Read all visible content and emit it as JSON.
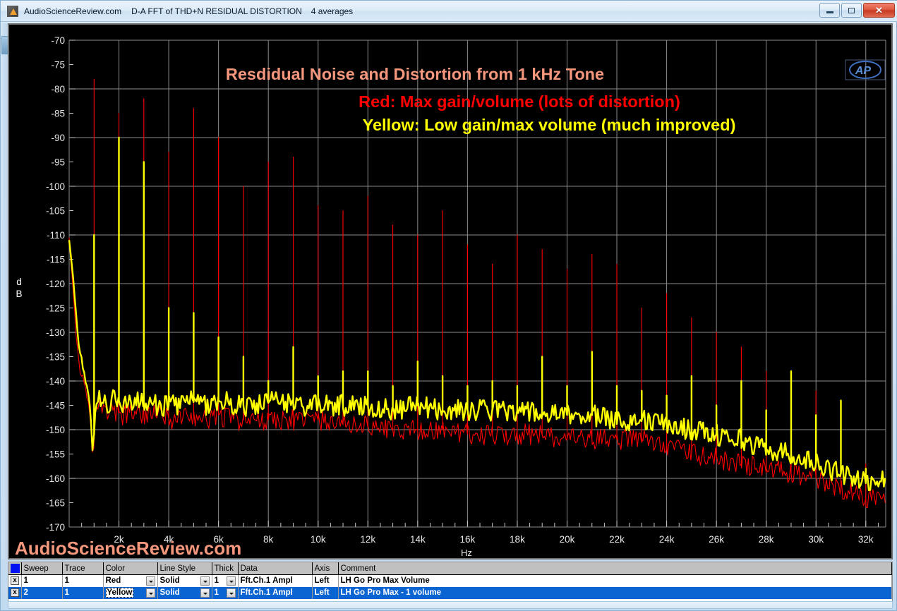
{
  "window": {
    "app_icon": "ap-app-icon",
    "title_site": "AudioScienceReview.com",
    "title_desc": "D-A FFT of THD+N RESIDUAL DISTORTION",
    "title_averages": "4 averages",
    "minimize_label": "–",
    "maximize_label": "□",
    "close_label": "✕"
  },
  "graph": {
    "ap_logo": "AP",
    "watermark": "AudioScienceReview.com",
    "watermark_color": "#F4977D",
    "annotations": [
      {
        "text": "Resdidual Noise and Distortion from 1 kHz Tone",
        "color": "#F4977D"
      },
      {
        "text": "Red: Max gain/volume (lots of distortion)",
        "color": "#FF0000"
      },
      {
        "text": "Yellow: Low gain/max volume (much improved)",
        "color": "#FFFF00"
      }
    ]
  },
  "chart_data": {
    "type": "line",
    "title": "Resdidual Noise and Distortion from 1 kHz Tone",
    "subtitle": "D-A FFT of THD+N RESIDUAL DISTORTION  4 averages",
    "xlabel": "Hz",
    "ylabel": "dB",
    "xlim": [
      0,
      32800
    ],
    "ylim": [
      -170,
      -70
    ],
    "ytick_step": 5,
    "yticks": [
      -70,
      -75,
      -80,
      -85,
      -90,
      -95,
      -100,
      -105,
      -110,
      -115,
      -120,
      -125,
      -130,
      -135,
      -140,
      -145,
      -150,
      -155,
      -160,
      -165,
      -170
    ],
    "xticks": [
      2000,
      4000,
      6000,
      8000,
      10000,
      12000,
      14000,
      16000,
      18000,
      20000,
      22000,
      24000,
      26000,
      28000,
      30000,
      32000
    ],
    "xticklabels": [
      "2k",
      "4k",
      "6k",
      "8k",
      "10k",
      "12k",
      "14k",
      "16k",
      "18k",
      "20k",
      "22k",
      "24k",
      "26k",
      "28k",
      "30k",
      "32k"
    ],
    "grid": true,
    "background": "#000000",
    "grid_color": "#8c8c8c",
    "legend_position": "table-below",
    "series": [
      {
        "name": "LH Go Pro Max Volume",
        "color": "#FF0000",
        "noise_floor": [
          [
            0,
            -110
          ],
          [
            120,
            -118
          ],
          [
            250,
            -128
          ],
          [
            400,
            -137
          ],
          [
            560,
            -140
          ],
          [
            700,
            -143
          ],
          [
            800,
            -146
          ],
          [
            900,
            -152
          ],
          [
            960,
            -157
          ],
          [
            1000,
            -152
          ],
          [
            1060,
            -146
          ],
          [
            1200,
            -145
          ],
          [
            1500,
            -147
          ],
          [
            1800,
            -146
          ],
          [
            2200,
            -147
          ],
          [
            2600,
            -146
          ],
          [
            3000,
            -147
          ],
          [
            3600,
            -147
          ],
          [
            4200,
            -148
          ],
          [
            4800,
            -147
          ],
          [
            5400,
            -148
          ],
          [
            6000,
            -147
          ],
          [
            6800,
            -148
          ],
          [
            7600,
            -148
          ],
          [
            8400,
            -148
          ],
          [
            9200,
            -148
          ],
          [
            10000,
            -148
          ],
          [
            11000,
            -149
          ],
          [
            12000,
            -149
          ],
          [
            13000,
            -150
          ],
          [
            14000,
            -150
          ],
          [
            15000,
            -150
          ],
          [
            16000,
            -151
          ],
          [
            17000,
            -151
          ],
          [
            18000,
            -151
          ],
          [
            19000,
            -151
          ],
          [
            20000,
            -152
          ],
          [
            21000,
            -152
          ],
          [
            22000,
            -152
          ],
          [
            23000,
            -152
          ],
          [
            24000,
            -153
          ],
          [
            25000,
            -155
          ],
          [
            26000,
            -156
          ],
          [
            27000,
            -157
          ],
          [
            28000,
            -158
          ],
          [
            29000,
            -159
          ],
          [
            30000,
            -160
          ],
          [
            31000,
            -162
          ],
          [
            32000,
            -164
          ],
          [
            32800,
            -163
          ]
        ],
        "harmonics": [
          [
            1000,
            -78
          ],
          [
            2000,
            -85
          ],
          [
            3000,
            -82
          ],
          [
            4000,
            -93
          ],
          [
            5000,
            -84
          ],
          [
            6000,
            -90
          ],
          [
            7000,
            -100
          ],
          [
            8000,
            -95
          ],
          [
            9000,
            -94
          ],
          [
            10000,
            -104
          ],
          [
            11000,
            -105
          ],
          [
            12000,
            -102
          ],
          [
            13000,
            -108
          ],
          [
            14000,
            -110
          ],
          [
            15000,
            -105
          ],
          [
            16000,
            -112
          ],
          [
            17000,
            -116
          ],
          [
            18000,
            -110
          ],
          [
            19000,
            -113
          ],
          [
            20000,
            -117
          ],
          [
            21000,
            -114
          ],
          [
            22000,
            -116
          ],
          [
            23000,
            -125
          ],
          [
            24000,
            -122
          ],
          [
            25000,
            -127
          ],
          [
            26000,
            -130
          ],
          [
            27000,
            -133
          ],
          [
            28000,
            -138
          ],
          [
            29000,
            -140
          ],
          [
            30000,
            -142
          ],
          [
            31000,
            -148
          ],
          [
            32000,
            -157
          ]
        ]
      },
      {
        "name": "LH Go Pro Max - 1 volume",
        "color": "#FFFF00",
        "noise_floor": [
          [
            0,
            -110
          ],
          [
            120,
            -116
          ],
          [
            250,
            -124
          ],
          [
            400,
            -133
          ],
          [
            560,
            -138
          ],
          [
            700,
            -140
          ],
          [
            800,
            -143
          ],
          [
            900,
            -150
          ],
          [
            960,
            -156
          ],
          [
            1000,
            -151
          ],
          [
            1060,
            -144
          ],
          [
            1200,
            -143
          ],
          [
            1500,
            -145
          ],
          [
            1800,
            -143
          ],
          [
            2200,
            -145
          ],
          [
            2600,
            -144
          ],
          [
            3000,
            -145
          ],
          [
            3600,
            -145
          ],
          [
            4200,
            -145
          ],
          [
            4800,
            -144
          ],
          [
            5400,
            -145
          ],
          [
            6000,
            -144
          ],
          [
            6800,
            -145
          ],
          [
            7600,
            -145
          ],
          [
            8400,
            -144
          ],
          [
            9200,
            -145
          ],
          [
            10000,
            -145
          ],
          [
            11000,
            -145
          ],
          [
            12000,
            -145
          ],
          [
            13000,
            -146
          ],
          [
            14000,
            -145
          ],
          [
            15000,
            -146
          ],
          [
            16000,
            -146
          ],
          [
            17000,
            -146
          ],
          [
            18000,
            -146
          ],
          [
            19000,
            -147
          ],
          [
            20000,
            -147
          ],
          [
            21000,
            -147
          ],
          [
            22000,
            -148
          ],
          [
            23000,
            -148
          ],
          [
            24000,
            -149
          ],
          [
            25000,
            -150
          ],
          [
            26000,
            -151
          ],
          [
            27000,
            -152
          ],
          [
            28000,
            -154
          ],
          [
            29000,
            -155
          ],
          [
            30000,
            -157
          ],
          [
            31000,
            -159
          ],
          [
            32000,
            -161
          ],
          [
            32800,
            -160
          ]
        ],
        "harmonics": [
          [
            1000,
            -110
          ],
          [
            2000,
            -90
          ],
          [
            3000,
            -95
          ],
          [
            4000,
            -125
          ],
          [
            5000,
            -126
          ],
          [
            6000,
            -131
          ],
          [
            7000,
            -135
          ],
          [
            8000,
            -140
          ],
          [
            9000,
            -133
          ],
          [
            10000,
            -139
          ],
          [
            11000,
            -138
          ],
          [
            12000,
            -138
          ],
          [
            13000,
            -141
          ],
          [
            14000,
            -136
          ],
          [
            15000,
            -139
          ],
          [
            16000,
            -141
          ],
          [
            17000,
            -140
          ],
          [
            18000,
            -141
          ],
          [
            19000,
            -135
          ],
          [
            20000,
            -141
          ],
          [
            21000,
            -134
          ],
          [
            22000,
            -141
          ],
          [
            23000,
            -142
          ],
          [
            24000,
            -143
          ],
          [
            25000,
            -139
          ],
          [
            26000,
            -145
          ],
          [
            27000,
            -140
          ],
          [
            28000,
            -146
          ],
          [
            29000,
            -138
          ],
          [
            30000,
            -147
          ],
          [
            31000,
            -144
          ],
          [
            32000,
            -158
          ]
        ]
      }
    ]
  },
  "legend_table": {
    "swatch_color": "#0010F0",
    "columns": [
      "",
      "Sweep",
      "Trace",
      "Color",
      "Line Style",
      "Thick",
      "Data",
      "Axis",
      "Comment"
    ],
    "rows": [
      {
        "check": "x",
        "sweep": "1",
        "trace": "1",
        "color": "Red",
        "line_style": "Solid",
        "thick": "1",
        "data": "Fft.Ch.1 Ampl",
        "axis": "Left",
        "comment": "LH Go Pro Max Volume",
        "selected": false
      },
      {
        "check": "x",
        "sweep": "2",
        "trace": "1",
        "color": "Yellow",
        "line_style": "Solid",
        "thick": "1",
        "data": "Fft.Ch.1 Ampl",
        "axis": "Left",
        "comment": "LH Go Pro Max - 1 volume",
        "selected": true
      }
    ]
  }
}
